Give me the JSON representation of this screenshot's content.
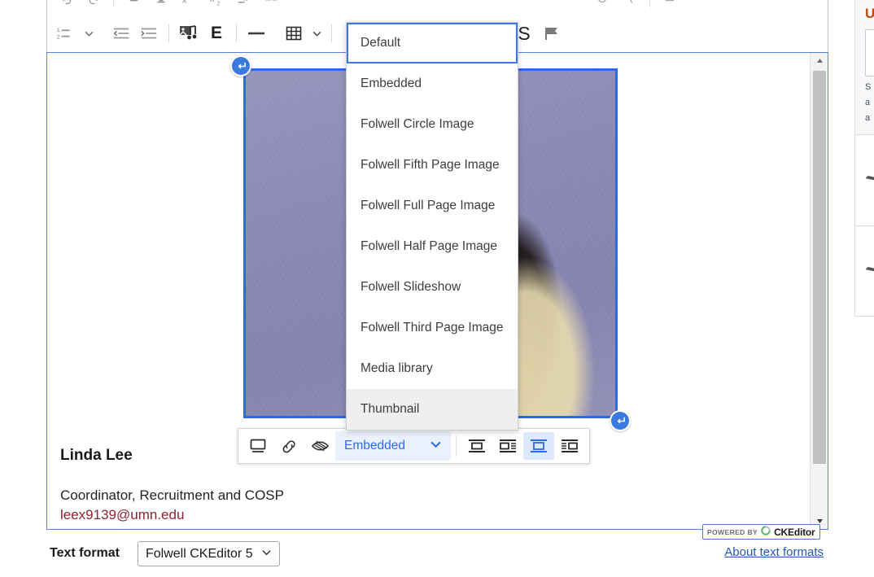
{
  "editor": {
    "name": "CKEditor 5 rich text editor",
    "toolbar_top_icons": [
      "undo-icon",
      "redo-icon",
      "paste-icon",
      "underline-icon",
      "superscript-icon",
      "subscript-icon",
      "remove-format-icon",
      "font-color-icon",
      "highlight-icon",
      "special-character-icon",
      "source-editing-icon"
    ],
    "toolbar_bottom": [
      {
        "name": "numbered-list-icon",
        "label": "Numbered List"
      },
      {
        "name": "list-options-chevron-icon",
        "label": "List options"
      },
      {
        "name": "decrease-indent-icon",
        "label": "Decrease indent"
      },
      {
        "name": "increase-indent-icon",
        "label": "Increase indent"
      },
      {
        "name": "insert-media-icon",
        "label": "Insert media"
      },
      {
        "name": "embed-icon",
        "label": "E"
      },
      {
        "name": "horizontal-line-icon",
        "label": "Horizontal line"
      },
      {
        "name": "insert-table-icon",
        "label": "Insert table"
      },
      {
        "name": "table-options-chevron-icon",
        "label": "Table options"
      },
      {
        "name": "strikethrough-s-icon",
        "label": "S"
      },
      {
        "name": "flag-icon",
        "label": "Flag"
      }
    ]
  },
  "image": {
    "selected": true,
    "alt": "Portrait of a person with dark hair in a tan jacket against a lavender backdrop",
    "selection_border_color": "#2e6ae6",
    "handle_icon": "return-arrow-icon"
  },
  "style_menu": {
    "open": true,
    "focused_index": 0,
    "hovered_index": 9,
    "items": [
      "Default",
      "Embedded",
      "Folwell Circle Image",
      "Folwell Fifth Page Image",
      "Folwell Full Page Image",
      "Folwell Half Page Image",
      "Folwell Slideshow",
      "Folwell Third Page Image",
      "Media library",
      "Thumbnail"
    ]
  },
  "image_toolbar": {
    "buttons_left": [
      {
        "name": "display-preview-icon",
        "label": "Preview"
      },
      {
        "name": "link-icon",
        "label": "Link image"
      },
      {
        "name": "hide-image-icon",
        "label": "Toggle image visibility"
      }
    ],
    "style_dropdown": {
      "value": "Embedded",
      "chevron": "chevron-down-icon",
      "accent_color": "#2e6ae6",
      "background_color": "#eaf1fd"
    },
    "alignment_buttons": [
      {
        "name": "image-inline-icon",
        "label": "Inline image",
        "active": false
      },
      {
        "name": "image-wrap-left-icon",
        "label": "Wrap text left",
        "active": false
      },
      {
        "name": "image-break-text-icon",
        "label": "Break text",
        "active": true
      },
      {
        "name": "image-wrap-right-icon",
        "label": "Wrap text right",
        "active": false
      }
    ]
  },
  "content": {
    "name": "Linda Lee",
    "role": "Coordinator, Recruitment and COSP",
    "email": "leex9139@umn.edu",
    "email_color": "#8b2332"
  },
  "footer": {
    "text_format_label": "Text format",
    "text_format_value": "Folwell CKEditor 5",
    "text_format_chevron": "chevron-down-icon",
    "about_link": "About text formats",
    "powered_by": "POWERED BY",
    "brand": "CKEditor"
  },
  "side_panel": {
    "title": "U",
    "lines": [
      "S",
      "a",
      "a"
    ]
  },
  "scrollbar": {
    "up_arrow": "triangle-up-icon",
    "down_arrow": "triangle-down-icon"
  }
}
